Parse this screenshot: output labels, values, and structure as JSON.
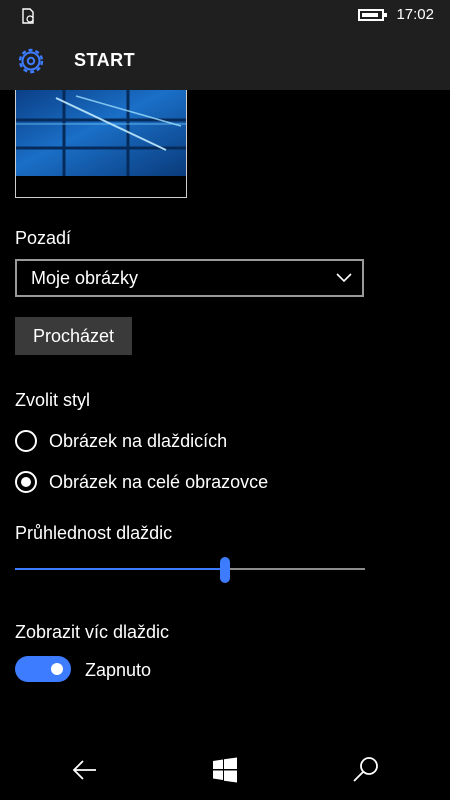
{
  "status_bar": {
    "time": "17:02",
    "left_icon": "notification-icon",
    "battery_icon": "battery-icon"
  },
  "header": {
    "title": "START",
    "icon": "gear-icon"
  },
  "background_preview": {
    "icon": "wallpaper-preview-image"
  },
  "background": {
    "label": "Pozadí",
    "dropdown_value": "Moje obrázky",
    "browse_label": "Procházet"
  },
  "style": {
    "label": "Zvolit styl",
    "options": [
      {
        "label": "Obrázek na dlaždicích",
        "selected": false
      },
      {
        "label": "Obrázek na celé obrazovce",
        "selected": true
      }
    ]
  },
  "transparency": {
    "label": "Průhlednost dlaždic",
    "value_percent": 60
  },
  "more_tiles": {
    "label": "Zobrazit víc dlaždic",
    "toggle_state": "Zapnuto",
    "on": true
  },
  "nav_bar": {
    "back_icon": "back-arrow-icon",
    "home_icon": "windows-logo-icon",
    "search_icon": "search-icon"
  },
  "colors": {
    "accent": "#3d7cff",
    "header_bg": "#1f1f1f",
    "background": "#000000"
  }
}
